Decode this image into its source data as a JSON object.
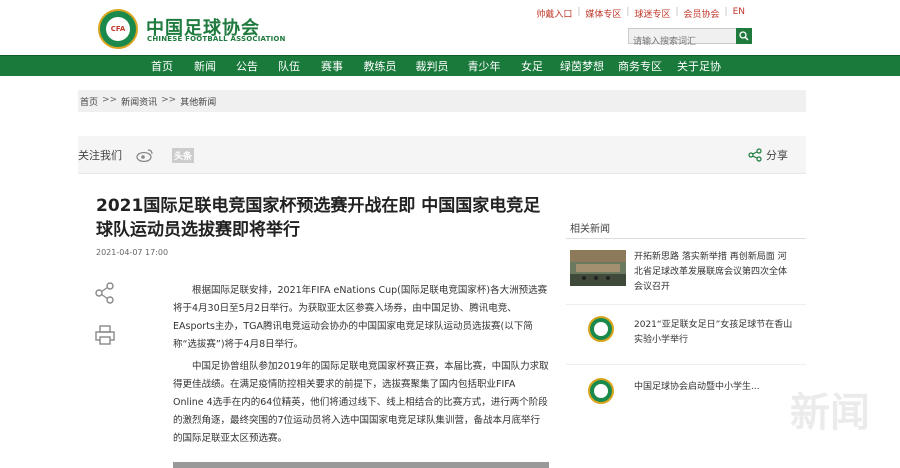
{
  "header": {
    "logo_cn": "中国足球协会",
    "logo_en": "CHINESE FOOTBALL ASSOCIATION",
    "emblem_text": "CFA",
    "toplinks": [
      "帅戴入口",
      "媒体专区",
      "球迷专区",
      "会员协会",
      "EN"
    ],
    "search_placeholder": "请输入搜索词汇"
  },
  "nav": {
    "items": [
      "首页",
      "新闻",
      "公告",
      "队伍",
      "赛事",
      "教练员",
      "裁判员",
      "青少年",
      "女足",
      "绿茵梦想",
      "商务专区",
      "关于足协"
    ]
  },
  "breadcrumb": {
    "items": [
      "首页",
      "新闻资讯",
      "其他新闻"
    ],
    "separator": ">>"
  },
  "sharebar": {
    "follow_label": "关注我们",
    "toutiao_label": "头条",
    "share_label": "分享"
  },
  "article": {
    "title": "2021国际足联电竞国家杯预选赛开战在即 中国国家电竞足球队运动员选拔赛即将举行",
    "date": "2021-04-07 17:00",
    "paragraphs": [
      "根据国际足联安排，2021年FIFA eNations Cup(国际足联电竞国家杯)各大洲预选赛将于4月30日至5月2日举行。为获取亚太区参赛入场券，由中国足协、腾讯电竞、EAsports主办，TGA腾讯电竞运动会协办的中国国家电竞足球队运动员选拔赛(以下简称“选拔赛”)将于4月8日举行。",
      "中国足协曾组队参加2019年的国际足联电竞国家杯赛正赛，本届比赛，中国队力求取得更佳战绩。在满足疫情防控相关要求的前提下，选拔赛聚集了国内包括职业FIFA Online 4选手在内的64位精英，他们将通过线下、线上相结合的比赛方式，进行两个阶段的激烈角逐，最终突围的7位运动员将入选中国国家电竞足球队集训营，备战本月底举行的国际足联亚太区预选赛。"
    ]
  },
  "sidebar": {
    "related_title": "相关新闻",
    "items": [
      {
        "text": "开拓新思路 落实新举措 再创新局面 河北省足球改革发展联席会议第四次全体会议召开"
      },
      {
        "text": "2021“亚足联女足日”女孩足球节在香山实验小学举行"
      },
      {
        "text": "中国足球协会启动暨中小学生..."
      }
    ]
  },
  "watermark": "新闻",
  "colors": {
    "brand_green": "#1a7a3c",
    "accent_red": "#c0392b"
  }
}
